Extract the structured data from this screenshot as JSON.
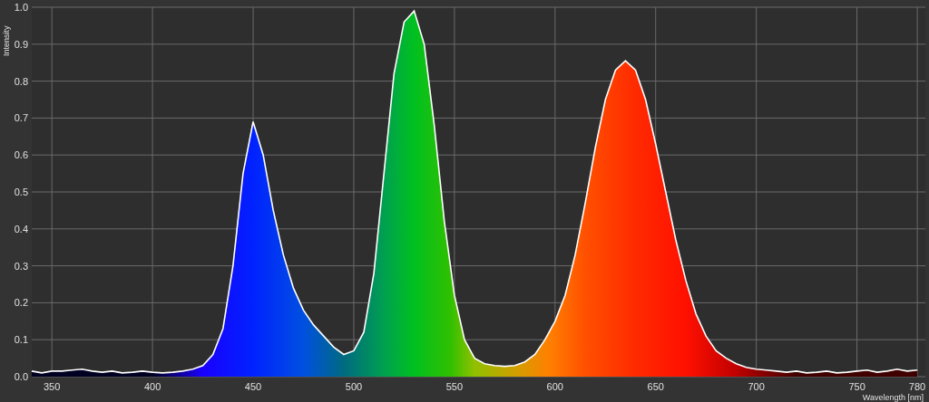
{
  "chart": {
    "chart_data": {
      "type": "area",
      "grid": true,
      "xlabel": "Wavelength [nm]",
      "ylabel": "Intensity",
      "xlim": [
        340,
        784
      ],
      "ylim": [
        0,
        1
      ],
      "xticks": [
        350,
        400,
        450,
        500,
        550,
        600,
        650,
        700,
        750,
        780
      ],
      "yticks": [
        {
          "value": 0,
          "label": "0.0"
        },
        {
          "value": 0.1,
          "label": "0.1"
        },
        {
          "value": 0.2,
          "label": "0.2"
        },
        {
          "value": 0.3,
          "label": "0.3"
        },
        {
          "value": 0.4,
          "label": "0.4"
        },
        {
          "value": 0.5,
          "label": "0.5"
        },
        {
          "value": 0.6,
          "label": "0.6"
        },
        {
          "value": 0.7,
          "label": "0.7"
        },
        {
          "value": 0.8,
          "label": "0.8"
        },
        {
          "value": 0.9,
          "label": "0.9"
        },
        {
          "value": 1,
          "label": "1.0"
        }
      ],
      "x": [
        340,
        345,
        350,
        355,
        360,
        365,
        370,
        375,
        380,
        385,
        390,
        395,
        400,
        405,
        410,
        415,
        420,
        425,
        430,
        435,
        440,
        445,
        450,
        455,
        460,
        465,
        470,
        475,
        480,
        485,
        490,
        495,
        500,
        505,
        510,
        515,
        520,
        525,
        530,
        535,
        540,
        545,
        550,
        555,
        560,
        565,
        570,
        575,
        580,
        585,
        590,
        595,
        600,
        605,
        610,
        615,
        620,
        625,
        630,
        635,
        640,
        645,
        650,
        655,
        660,
        665,
        670,
        675,
        680,
        685,
        690,
        695,
        700,
        705,
        710,
        715,
        720,
        725,
        730,
        735,
        740,
        745,
        750,
        755,
        760,
        765,
        770,
        775,
        780
      ],
      "series": [
        {
          "color": "#ffffff",
          "values": [
            0.015,
            0.01,
            0.015,
            0.015,
            0.018,
            0.02,
            0.015,
            0.012,
            0.015,
            0.01,
            0.012,
            0.015,
            0.012,
            0.01,
            0.012,
            0.015,
            0.02,
            0.03,
            0.06,
            0.13,
            0.3,
            0.55,
            0.69,
            0.6,
            0.45,
            0.33,
            0.24,
            0.18,
            0.14,
            0.11,
            0.08,
            0.06,
            0.07,
            0.12,
            0.28,
            0.55,
            0.82,
            0.96,
            0.99,
            0.9,
            0.68,
            0.42,
            0.22,
            0.1,
            0.05,
            0.035,
            0.03,
            0.028,
            0.03,
            0.04,
            0.06,
            0.1,
            0.15,
            0.22,
            0.33,
            0.47,
            0.62,
            0.75,
            0.83,
            0.855,
            0.83,
            0.75,
            0.63,
            0.5,
            0.37,
            0.26,
            0.17,
            0.11,
            0.07,
            0.05,
            0.035,
            0.025,
            0.02,
            0.018,
            0.015,
            0.012,
            0.015,
            0.01,
            0.012,
            0.015,
            0.01,
            0.012,
            0.015,
            0.018,
            0.012,
            0.015,
            0.02,
            0.015,
            0.018
          ]
        }
      ]
    }
  }
}
